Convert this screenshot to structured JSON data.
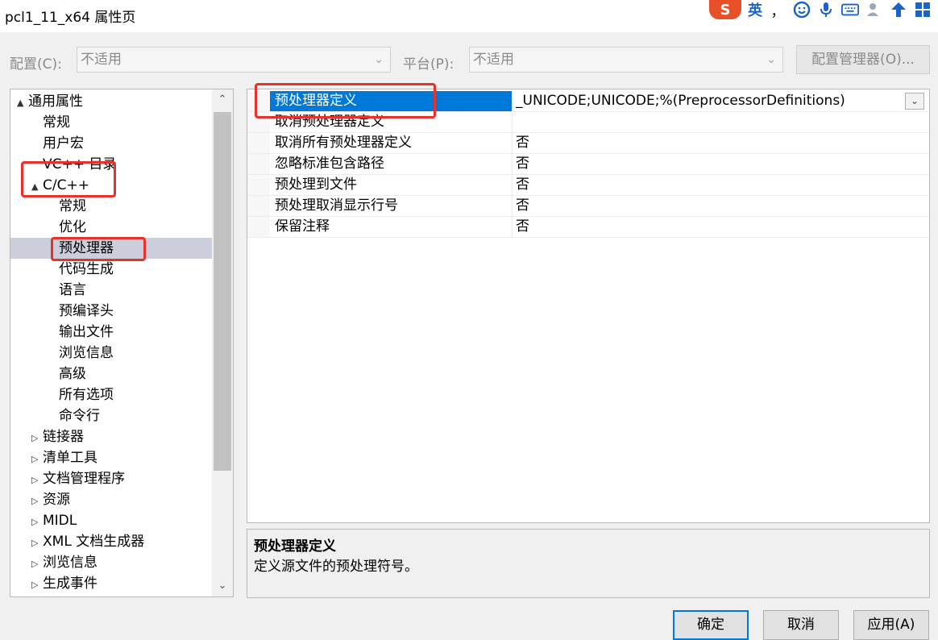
{
  "window": {
    "title": "pcl1_11_x64 属性页"
  },
  "ime": {
    "brand": "S",
    "mode": "英",
    "punct": "，"
  },
  "config": {
    "config_label": "配置(C):",
    "config_value": "不适用",
    "platform_label": "平台(P):",
    "platform_value": "不适用",
    "manager_button": "配置管理器(O)..."
  },
  "tree": {
    "items": [
      {
        "label": "通用属性",
        "level": 0,
        "toggle": "▲"
      },
      {
        "label": "常规",
        "level": 1,
        "toggle": ""
      },
      {
        "label": "用户宏",
        "level": 1,
        "toggle": ""
      },
      {
        "label": "VC++ 目录",
        "level": 1,
        "toggle": ""
      },
      {
        "label": "C/C++",
        "level": 1,
        "toggle": "▲"
      },
      {
        "label": "常规",
        "level": 2,
        "toggle": ""
      },
      {
        "label": "优化",
        "level": 2,
        "toggle": ""
      },
      {
        "label": "预处理器",
        "level": 2,
        "toggle": "",
        "selected": true
      },
      {
        "label": "代码生成",
        "level": 2,
        "toggle": ""
      },
      {
        "label": "语言",
        "level": 2,
        "toggle": ""
      },
      {
        "label": "预编译头",
        "level": 2,
        "toggle": ""
      },
      {
        "label": "输出文件",
        "level": 2,
        "toggle": ""
      },
      {
        "label": "浏览信息",
        "level": 2,
        "toggle": ""
      },
      {
        "label": "高级",
        "level": 2,
        "toggle": ""
      },
      {
        "label": "所有选项",
        "level": 2,
        "toggle": ""
      },
      {
        "label": "命令行",
        "level": 2,
        "toggle": ""
      },
      {
        "label": "链接器",
        "level": 1,
        "toggle": "▷"
      },
      {
        "label": "清单工具",
        "level": 1,
        "toggle": "▷"
      },
      {
        "label": "文档管理程序",
        "level": 1,
        "toggle": "▷"
      },
      {
        "label": "资源",
        "level": 1,
        "toggle": "▷"
      },
      {
        "label": "MIDL",
        "level": 1,
        "toggle": "▷"
      },
      {
        "label": "XML 文档生成器",
        "level": 1,
        "toggle": "▷"
      },
      {
        "label": "浏览信息",
        "level": 1,
        "toggle": "▷"
      },
      {
        "label": "生成事件",
        "level": 1,
        "toggle": "▷"
      }
    ]
  },
  "properties": [
    {
      "name": "预处理器定义",
      "value": "_UNICODE;UNICODE;%(PreprocessorDefinitions)",
      "selected": true
    },
    {
      "name": "取消预处理器定义",
      "value": ""
    },
    {
      "name": "取消所有预处理器定义",
      "value": "否"
    },
    {
      "name": "忽略标准包含路径",
      "value": "否"
    },
    {
      "name": "预处理到文件",
      "value": "否"
    },
    {
      "name": "预处理取消显示行号",
      "value": "否"
    },
    {
      "name": "保留注释",
      "value": "否"
    }
  ],
  "description": {
    "title": "预处理器定义",
    "text": "定义源文件的预处理符号。"
  },
  "buttons": {
    "ok": "确定",
    "cancel": "取消",
    "apply": "应用(A)"
  },
  "colors": {
    "accent": "#0078d7",
    "highlight": "#e8312a",
    "tree_selection": "#cccedb"
  }
}
